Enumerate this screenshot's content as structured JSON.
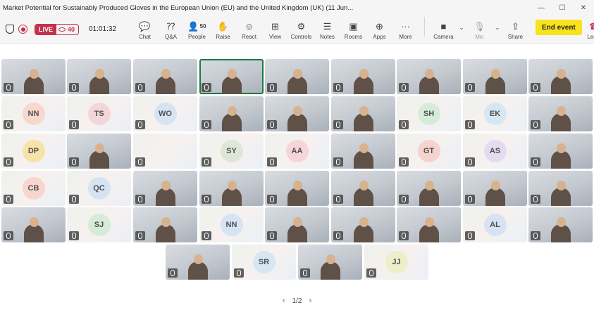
{
  "window": {
    "title": "Market Potential for Sustainably Produced Gloves in the European Union (EU) and the United Kingdom (UK) (11 Jun...",
    "minimize": "—",
    "maximize": "☐",
    "close": "✕"
  },
  "meeting": {
    "live_label": "LIVE",
    "viewers": "40",
    "timer": "01:01:32"
  },
  "toolbar": {
    "chat": {
      "label": "Chat",
      "icon": "chat-icon"
    },
    "qa": {
      "label": "Q&A",
      "icon": "qa-icon"
    },
    "people": {
      "label": "People",
      "count": "50",
      "icon": "people-icon"
    },
    "raise": {
      "label": "Raise",
      "icon": "raise-hand-icon"
    },
    "react": {
      "label": "React",
      "icon": "react-icon"
    },
    "view": {
      "label": "View",
      "icon": "view-icon"
    },
    "controls": {
      "label": "Controls",
      "icon": "controls-icon"
    },
    "notes": {
      "label": "Notes",
      "icon": "notes-icon"
    },
    "rooms": {
      "label": "Rooms",
      "icon": "rooms-icon"
    },
    "apps": {
      "label": "Apps",
      "icon": "apps-icon"
    },
    "more": {
      "label": "More",
      "icon": "more-icon"
    },
    "camera": {
      "label": "Camera",
      "icon": "camera-icon"
    },
    "mic": {
      "label": "Mic",
      "icon": "mic-icon"
    },
    "share": {
      "label": "Share",
      "icon": "share-icon"
    },
    "end_event": "End event",
    "leave": {
      "label": "Leave",
      "icon": "leave-phone-icon"
    }
  },
  "colors": {
    "live_red": "#c4314b",
    "end_event_yellow": "#f8e21d",
    "active_speaker_green": "#1c7c3b"
  },
  "tiles": [
    {
      "kind": "video"
    },
    {
      "kind": "video"
    },
    {
      "kind": "video"
    },
    {
      "kind": "video",
      "active": true
    },
    {
      "kind": "video"
    },
    {
      "kind": "video"
    },
    {
      "kind": "video"
    },
    {
      "kind": "video"
    },
    {
      "kind": "video"
    },
    {
      "kind": "avatar",
      "initials": "NN",
      "color": "#f8d7cc"
    },
    {
      "kind": "avatar",
      "initials": "TS",
      "color": "#f4d6d8"
    },
    {
      "kind": "avatar",
      "initials": "WO",
      "color": "#d6e3f2"
    },
    {
      "kind": "video"
    },
    {
      "kind": "video"
    },
    {
      "kind": "video"
    },
    {
      "kind": "avatar",
      "initials": "SH",
      "color": "#d6ecd9"
    },
    {
      "kind": "avatar",
      "initials": "EK",
      "color": "#d7e6f3"
    },
    {
      "kind": "video"
    },
    {
      "kind": "avatar",
      "initials": "DP",
      "color": "#f5e3a8"
    },
    {
      "kind": "video"
    },
    {
      "kind": "avatar",
      "initials": "",
      "color": "#eeeeee"
    },
    {
      "kind": "avatar",
      "initials": "SY",
      "color": "#dde7d8"
    },
    {
      "kind": "avatar",
      "initials": "AA",
      "color": "#f6d4d8"
    },
    {
      "kind": "video"
    },
    {
      "kind": "avatar",
      "initials": "GT",
      "color": "#f6d3cd"
    },
    {
      "kind": "avatar",
      "initials": "AS",
      "color": "#e2dcef"
    },
    {
      "kind": "video"
    },
    {
      "kind": "avatar",
      "initials": "CB",
      "color": "#f8d6cf"
    },
    {
      "kind": "avatar",
      "initials": "QC",
      "color": "#d7e3f2"
    },
    {
      "kind": "video"
    },
    {
      "kind": "video"
    },
    {
      "kind": "video"
    },
    {
      "kind": "video"
    },
    {
      "kind": "video"
    },
    {
      "kind": "video"
    },
    {
      "kind": "video"
    },
    {
      "kind": "video"
    },
    {
      "kind": "avatar",
      "initials": "SJ",
      "color": "#d6ecd9"
    },
    {
      "kind": "video"
    },
    {
      "kind": "avatar",
      "initials": "NN",
      "color": "#d6e3f2"
    },
    {
      "kind": "video"
    },
    {
      "kind": "video"
    },
    {
      "kind": "video"
    },
    {
      "kind": "avatar",
      "initials": "AL",
      "color": "#d7e3f2"
    },
    {
      "kind": "video"
    },
    {
      "kind": "video"
    },
    {
      "kind": "avatar",
      "initials": "SR",
      "color": "#d6e6f3"
    },
    {
      "kind": "video"
    },
    {
      "kind": "avatar",
      "initials": "JJ",
      "color": "#ecefc9"
    }
  ],
  "pagination": {
    "prev": "‹",
    "label": "1/2",
    "next": "›"
  }
}
